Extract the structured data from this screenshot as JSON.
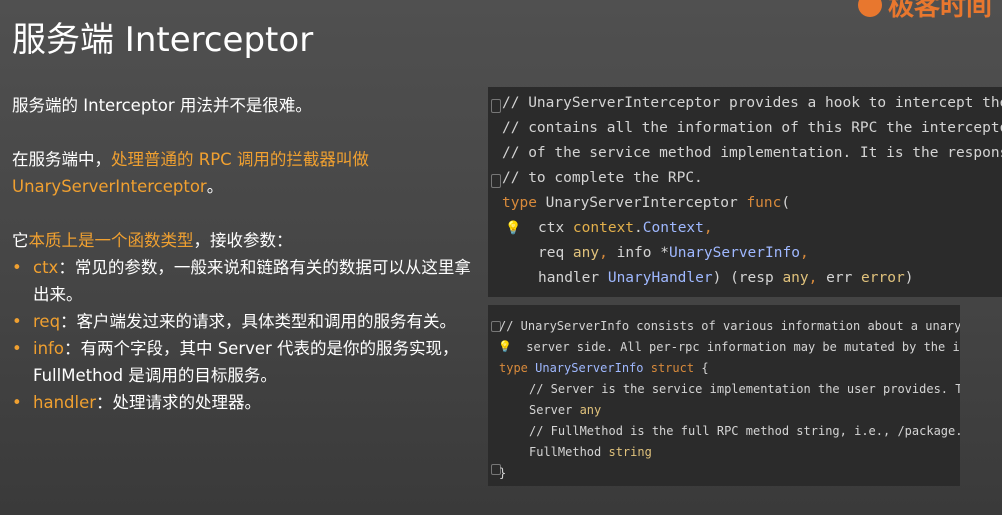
{
  "slide": {
    "title": "服务端 Interceptor",
    "logo_text": "极客时间"
  },
  "intro": "服务端的 Interceptor 用法并不是很难。",
  "para2": {
    "prefix": "在服务端中，",
    "highlight": "处理普通的 RPC 调用的拦截器叫做",
    "highlight2": "UnaryServerInterceptor",
    "suffix": "。"
  },
  "para3": {
    "prefix": "它",
    "highlight": "本质上是一个函数类型",
    "suffix": "，接收参数："
  },
  "bullets": [
    {
      "term": "ctx",
      "desc": "：常见的参数，一般来说和链路有关的数据可以从这里拿出来。"
    },
    {
      "term": "req",
      "desc": "：客户端发过来的请求，具体类型和调用的服务有关。"
    },
    {
      "term": "info",
      "desc": "：有两个字段，其中 Server 代表的是你的服务实现，FullMethod 是调用的目标服务。"
    },
    {
      "term": "handler",
      "desc": "：处理请求的处理器。"
    }
  ],
  "code1": {
    "comment1": "// UnaryServerInterceptor provides a hook to intercept the execution of a unary RPC on the server. info",
    "comment2": "// contains all the information of this RPC the interceptor can operate on. And handler is the wrapper",
    "comment3": "// of the service method implementation. It is the responsibility of the interceptor to invoke handler",
    "comment4": "// to complete the RPC.",
    "kw_type": "type",
    "type_name": " UnaryServerInterceptor ",
    "kw_func": "func",
    "open_paren": "(",
    "p_ctx": "ctx",
    "t_ctx_pkg": " context",
    "dot": ".",
    "t_ctx": "Context",
    "comma": ",",
    "p_req": "req",
    "t_any": " any",
    "p_info": " info ",
    "star": "*",
    "t_info": "UnaryServerInfo",
    "p_handler": "handler",
    "t_handler": " UnaryHandler",
    "close_resp": ") (resp",
    "p_err": " err",
    "t_error": " error",
    "close_paren": ")"
  },
  "code2": {
    "comment1": "// UnaryServerInfo consists of various information about a unary RPC on",
    "comment2": " server side. All per-rpc information may be mutated by the interceptor.",
    "kw_type": "type",
    "type_name": " UnaryServerInfo ",
    "kw_struct": "struct",
    "brace_open": " {",
    "comment3": "// Server is the service implementation the user provides. This is read-only.",
    "f_server": "Server",
    "t_any": " any",
    "comment4": "// FullMethod is the full RPC method string, i.e., /package.service/method.",
    "f_fullmethod": "FullMethod",
    "t_string": " string",
    "brace_close": "}"
  }
}
